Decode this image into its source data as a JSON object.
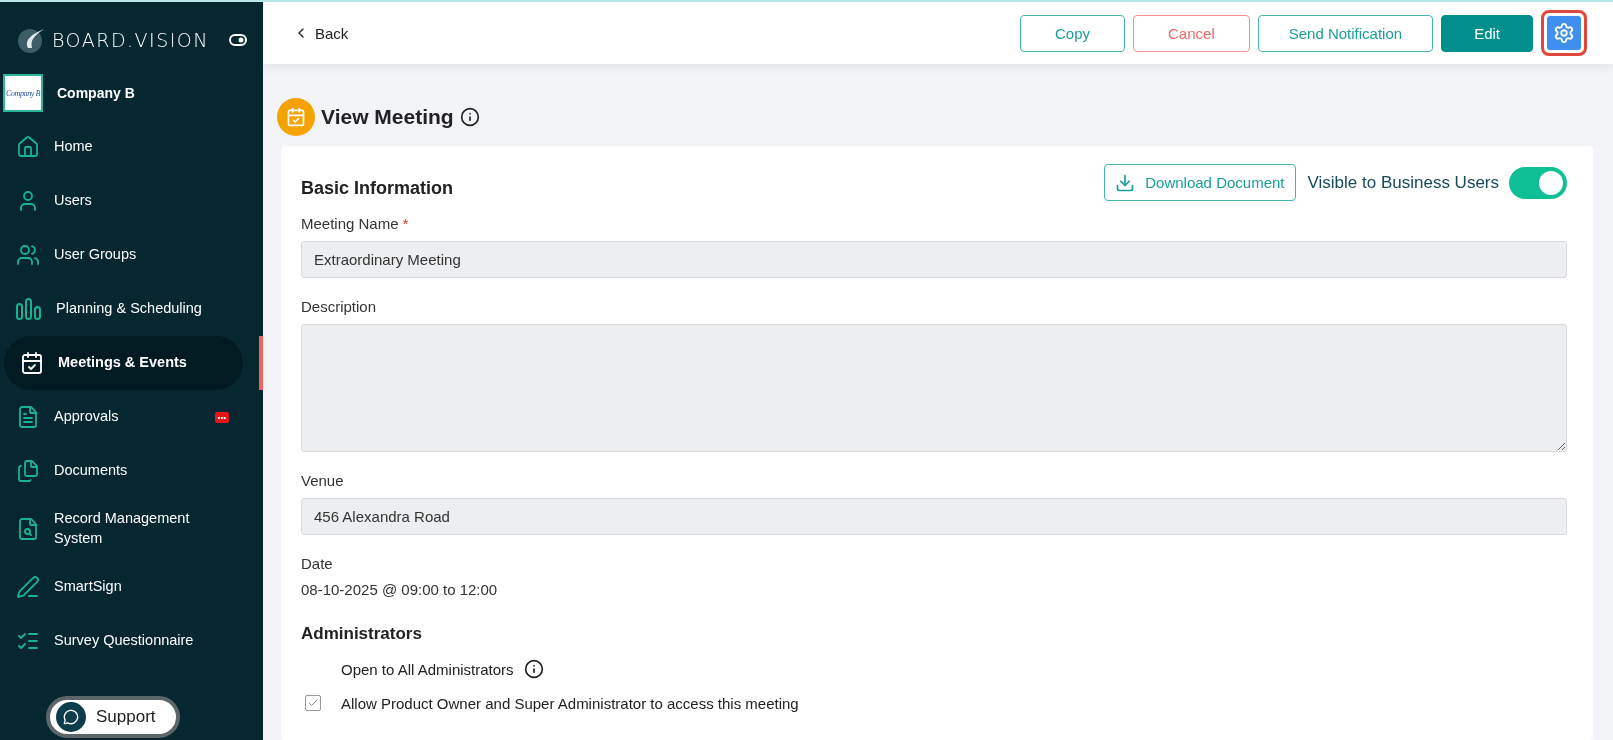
{
  "sidebar": {
    "brand": "BOARD.VISION",
    "company": {
      "logo_text": "Company B",
      "name": "Company B"
    },
    "items": [
      {
        "label": "Home",
        "kind": "home",
        "selected": false
      },
      {
        "label": "Users",
        "kind": "user",
        "selected": false
      },
      {
        "label": "User Groups",
        "kind": "users",
        "selected": false
      },
      {
        "label": "Planning & Scheduling",
        "kind": "bars",
        "selected": false
      },
      {
        "label": "Meetings & Events",
        "kind": "calendar",
        "selected": true
      },
      {
        "label": "Approvals",
        "kind": "doc",
        "selected": false,
        "badge": "•••"
      },
      {
        "label": "Documents",
        "kind": "docs",
        "selected": false
      },
      {
        "label": "Record Management System",
        "kind": "record",
        "selected": false
      },
      {
        "label": "SmartSign",
        "kind": "sign",
        "selected": false
      },
      {
        "label": "Survey Questionnaire",
        "kind": "list",
        "selected": false
      }
    ],
    "support": "Support"
  },
  "topbar": {
    "back": "Back",
    "buttons": [
      {
        "label": "Copy",
        "kind": "outline"
      },
      {
        "label": "Cancel",
        "kind": "danger"
      },
      {
        "label": "Send Notification",
        "kind": "outline"
      },
      {
        "label": "Edit",
        "kind": "primary"
      }
    ]
  },
  "page": {
    "title": "View Meeting"
  },
  "form": {
    "section": "Basic Information",
    "download": "Download Document",
    "visibility": {
      "label": "Visible to Business Users",
      "on": true
    },
    "fields": [
      {
        "label": "Meeting Name",
        "required_mark": "*",
        "kind": "input",
        "value": "Extraordinary Meeting"
      },
      {
        "label": "Description",
        "kind": "textarea"
      },
      {
        "label": "Venue",
        "kind": "input",
        "value": "456 Alexandra Road"
      },
      {
        "label": "Date",
        "kind": "text",
        "value": "08-10-2025 @ 09:00 to 12:00"
      }
    ],
    "admin_section": "Administrators",
    "admin_options": [
      {
        "label": "Open to All Administrators",
        "kind": "info"
      },
      {
        "label": "Allow Product Owner and Super Administrator to access this meeting",
        "kind": "checkbox",
        "checked": true
      }
    ]
  }
}
